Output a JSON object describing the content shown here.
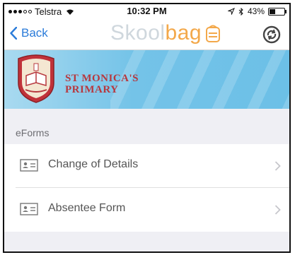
{
  "status": {
    "carrier": "Telstra",
    "time": "10:32 PM",
    "battery": "43%",
    "battery_level": 0.43
  },
  "nav": {
    "back_label": "Back",
    "brand_part1": "Skool",
    "brand_part2": "bag"
  },
  "banner": {
    "school_line1": "ST MONICA'S",
    "school_line2": "PRIMARY"
  },
  "section": {
    "header": "eForms"
  },
  "forms": [
    {
      "label": "Change of Details"
    },
    {
      "label": "Absentee Form"
    }
  ],
  "colors": {
    "accent": "#2a7bd9",
    "brand_orange": "#f3a84a",
    "school_red": "#b7383e",
    "banner_blue": "#74c3e8"
  },
  "icons": {
    "back": "chevron-left-icon",
    "sync": "sync-icon",
    "form_item": "idcard-icon",
    "disclosure": "chevron-right-icon"
  }
}
